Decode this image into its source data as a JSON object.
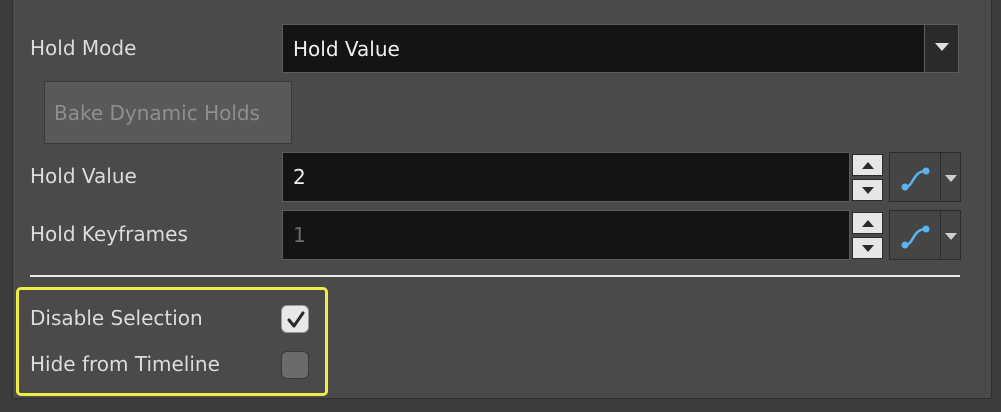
{
  "hold_mode": {
    "label": "Hold Mode",
    "selected": "Hold Value",
    "dropdown_icon": "chevron-down-icon"
  },
  "bake_button": {
    "label": "Bake Dynamic Holds",
    "enabled": false
  },
  "hold_value": {
    "label": "Hold Value",
    "value": "2"
  },
  "hold_keyframes": {
    "label": "Hold Keyframes",
    "value": "1",
    "enabled": false
  },
  "options": {
    "disable_selection": {
      "label": "Disable Selection",
      "checked": true
    },
    "hide_from_timeline": {
      "label": "Hide from Timeline",
      "checked": false
    }
  },
  "colors": {
    "highlight": "#f2ee48",
    "curve_icon": "#5ab4f0"
  }
}
